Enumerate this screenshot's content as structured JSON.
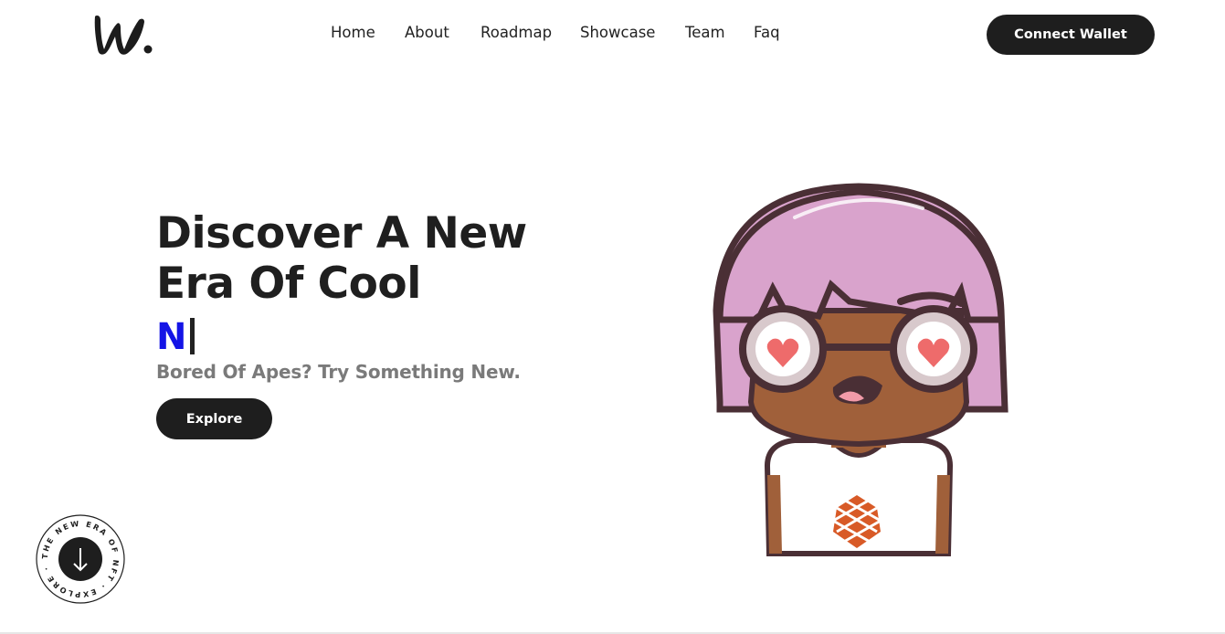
{
  "logo": {
    "text": "w."
  },
  "nav": {
    "items": [
      {
        "label": "Home"
      },
      {
        "label": "About"
      },
      {
        "label": "Roadmap"
      },
      {
        "label": "Showcase"
      },
      {
        "label": "Team"
      },
      {
        "label": "Faq"
      }
    ]
  },
  "header": {
    "connect_label": "Connect Wallet"
  },
  "hero": {
    "title_line1": "Discover A New",
    "title_line2": "Era Of Cool",
    "typed_text": "N",
    "subtitle": "Bored Of Apes? Try Something New.",
    "explore_label": "Explore"
  },
  "badge": {
    "ring_text": "THE NEW ERA OF NFT · EXPLORE ·"
  },
  "colors": {
    "accent_blue": "#1414e6",
    "button_dark": "#1e1e1e",
    "hair_pink": "#d9a3cc",
    "skin_brown": "#a0603a"
  },
  "icons": {
    "badge_arrow": "arrow-down-icon",
    "character": "nft-character-illustration"
  }
}
